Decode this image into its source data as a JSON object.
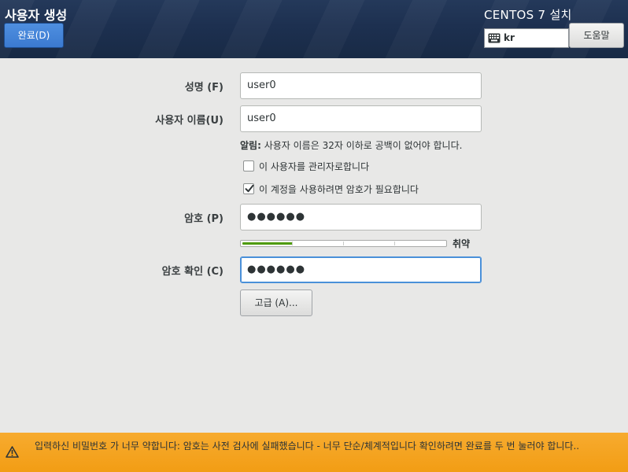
{
  "header": {
    "title": "사용자 생성",
    "done_label": "완료(D)",
    "product_title": "CENTOS 7 설치",
    "keyboard_layout": "kr",
    "help_label": "도움말"
  },
  "form": {
    "fullname": {
      "label": "성명 (F)",
      "value": "user0"
    },
    "username": {
      "label": "사용자 이름(U)",
      "value": "user0"
    },
    "hint": {
      "title": "알림:",
      "text": " 사용자 이름은 32자 이하로 공백이 없어야 합니다."
    },
    "admin_checkbox": {
      "label": "이 사용자를 관리자로합니다",
      "checked": false
    },
    "require_password_checkbox": {
      "label": "이 계정을 사용하려면 암호가 필요합니다",
      "checked": true
    },
    "password": {
      "label": "암호 (P)",
      "value": "●●●●●●"
    },
    "strength": {
      "label": "취약",
      "level": 0.25
    },
    "confirm": {
      "label": "암호 확인 (C)",
      "value": "●●●●●●"
    },
    "advanced_label": "고급 (A)..."
  },
  "warning": {
    "text": "입력하신 비밀번호 가 너무 약합니다: 암호는 사전 검사에 실패했습니다  - 너무 단순/체계적입니다   확인하려면 완료를 두 번 눌러야 합니다.."
  },
  "colors": {
    "header_bg": "#1d3050",
    "primary_button": "#3b7ad0",
    "strength_fill": "#4e9a06",
    "focus_border": "#4a90d9",
    "warning_bg": "#f5a623"
  }
}
